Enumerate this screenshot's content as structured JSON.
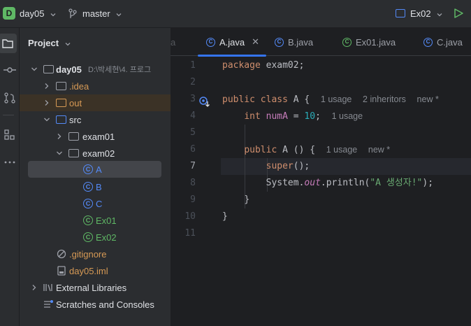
{
  "header": {
    "project_badge": "D",
    "project_name": "day05",
    "branch_name": "master",
    "run_config": "Ex02"
  },
  "project_panel": {
    "title": "Project",
    "tree": [
      {
        "label": "day05",
        "path_hint": "D:\\박세현\\4. 프로그",
        "type": "module"
      },
      {
        "label": ".idea",
        "type": "folder"
      },
      {
        "label": "out",
        "type": "folder-excluded"
      },
      {
        "label": "src",
        "type": "folder-source"
      },
      {
        "label": "exam01",
        "type": "package"
      },
      {
        "label": "exam02",
        "type": "package"
      },
      {
        "label": "A",
        "type": "class"
      },
      {
        "label": "B",
        "type": "class"
      },
      {
        "label": "C",
        "type": "class"
      },
      {
        "label": "Ex01",
        "type": "class-main"
      },
      {
        "label": "Ex02",
        "type": "class-main"
      },
      {
        "label": ".gitignore",
        "type": "file"
      },
      {
        "label": "day05.iml",
        "type": "file"
      },
      {
        "label": "External Libraries",
        "type": "libraries"
      },
      {
        "label": "Scratches and Consoles",
        "type": "scratches"
      }
    ]
  },
  "tabs": [
    {
      "label": "a",
      "partial": true
    },
    {
      "label": "A.java",
      "active": true
    },
    {
      "label": "B.java"
    },
    {
      "label": "Ex01.java"
    },
    {
      "label": "C.java"
    }
  ],
  "editor": {
    "line_numbers": [
      "1",
      "2",
      "3",
      "4",
      "5",
      "6",
      "7",
      "8",
      "9",
      "10",
      "11"
    ],
    "current_line": "7",
    "code": {
      "l1_kw": "package",
      "l1_rest": " exam02;",
      "l3_kw1": "public",
      "l3_kw2": "class",
      "l3_rest": " A {",
      "l3_hint1": "1 usage",
      "l3_hint2": "2 inheritors",
      "l3_hint3": "new *",
      "l4_kw": "int",
      "l4_field": "numA",
      "l4_eq": " = ",
      "l4_num": "10",
      "l4_semi": ";",
      "l4_hint": "1 usage",
      "l6_kw": "public",
      "l6_rest": " A () {",
      "l6_hint1": "1 usage",
      "l6_hint2": "new *",
      "l7_kw": "super",
      "l7_rest": "();",
      "l8_pre": "System.",
      "l8_out": "out",
      "l8_mid": ".println(",
      "l8_str": "\"A 생성자!\"",
      "l8_end": ");",
      "l9": "}",
      "l10": "}"
    }
  }
}
